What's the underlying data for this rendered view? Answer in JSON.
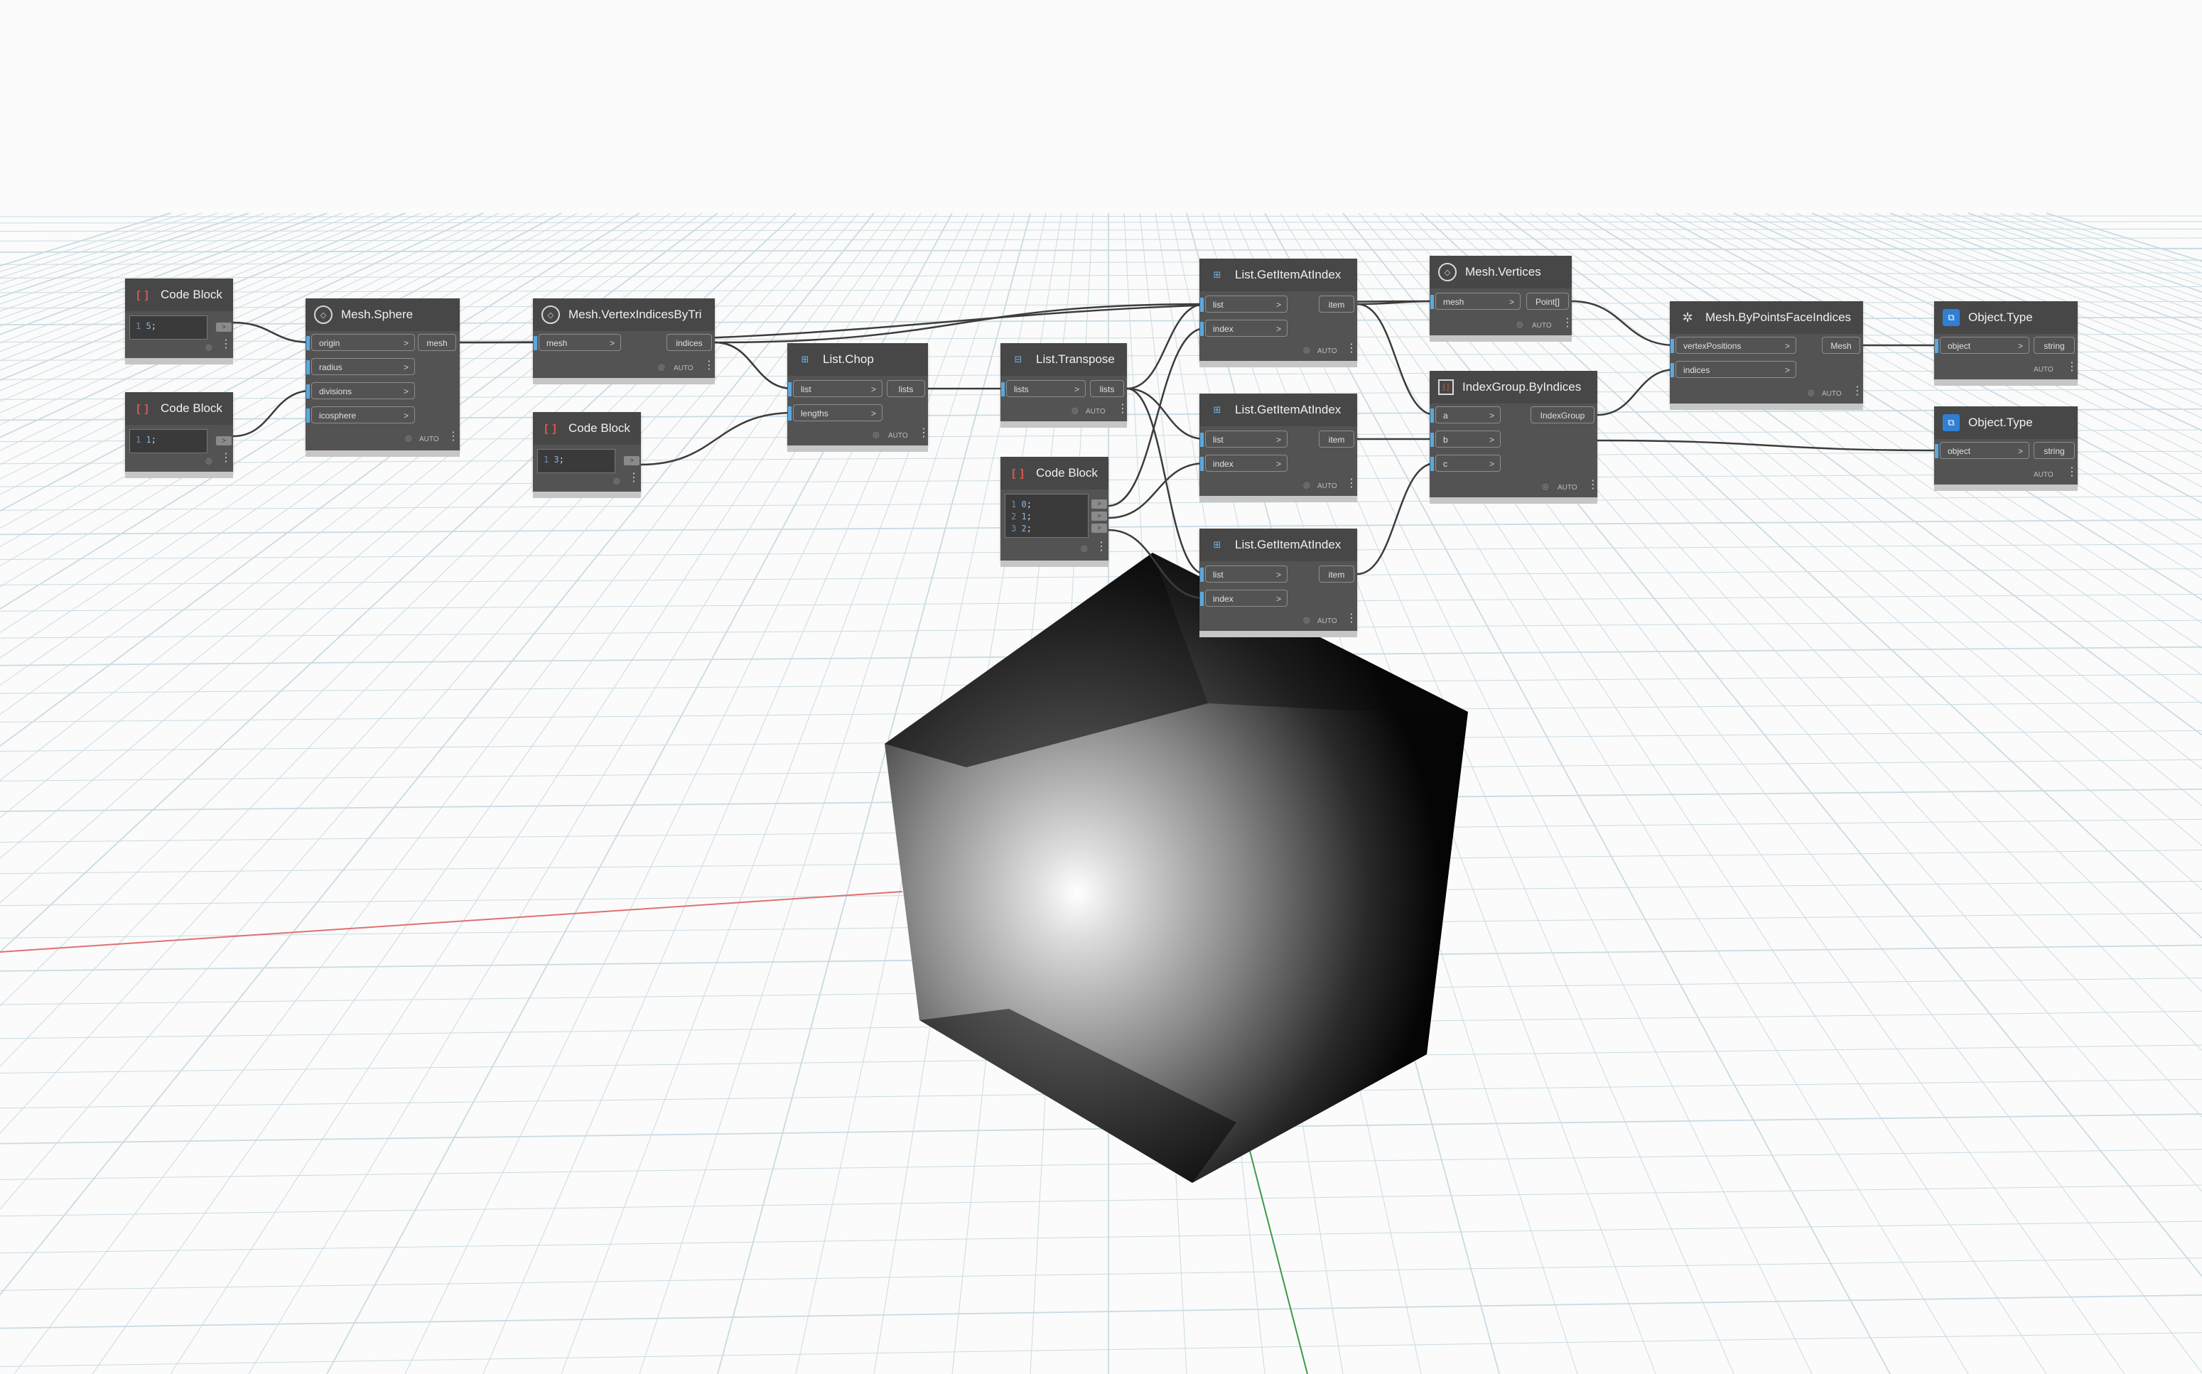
{
  "canvas": {
    "background": "#fbfbfb"
  },
  "nodes": {
    "cb1": {
      "title": "Code Block",
      "line_no": "1",
      "code": "5",
      "terminator": ";"
    },
    "cb2": {
      "title": "Code Block",
      "line_no": "1",
      "code": "1",
      "terminator": ";"
    },
    "cb3": {
      "title": "Code Block",
      "line_no": "1",
      "code": "3",
      "terminator": ";"
    },
    "cb4": {
      "title": "Code Block",
      "lines": [
        {
          "no": "1",
          "code": "0",
          "t": ";"
        },
        {
          "no": "2",
          "code": "1",
          "t": ";"
        },
        {
          "no": "3",
          "code": "2",
          "t": ";"
        }
      ]
    },
    "mesh_sphere": {
      "title": "Mesh.Sphere",
      "inputs": [
        "origin",
        "radius",
        "divisions",
        "icosphere"
      ],
      "output": "mesh",
      "lacing": "AUTO"
    },
    "vertex_indices": {
      "title": "Mesh.VertexIndicesByTri",
      "inputs": [
        "mesh"
      ],
      "output": "indices",
      "lacing": "AUTO"
    },
    "list_chop": {
      "title": "List.Chop",
      "inputs": [
        "list",
        "lengths"
      ],
      "output": "lists",
      "lacing": "AUTO"
    },
    "list_transpose": {
      "title": "List.Transpose",
      "inputs": [
        "lists"
      ],
      "output": "lists",
      "lacing": "AUTO"
    },
    "get_item_1": {
      "title": "List.GetItemAtIndex",
      "inputs": [
        "list",
        "index"
      ],
      "output": "item",
      "lacing": "AUTO"
    },
    "get_item_2": {
      "title": "List.GetItemAtIndex",
      "inputs": [
        "list",
        "index"
      ],
      "output": "item",
      "lacing": "AUTO"
    },
    "get_item_3": {
      "title": "List.GetItemAtIndex",
      "inputs": [
        "list",
        "index"
      ],
      "output": "item",
      "lacing": "AUTO"
    },
    "mesh_vertices": {
      "title": "Mesh.Vertices",
      "inputs": [
        "mesh"
      ],
      "output": "Point[]",
      "lacing": "AUTO"
    },
    "index_group": {
      "title": "IndexGroup.ByIndices",
      "inputs": [
        "a",
        "b",
        "c"
      ],
      "output": "IndexGroup",
      "lacing": "AUTO"
    },
    "mesh_by_points": {
      "title": "Mesh.ByPointsFaceIndices",
      "inputs": [
        "vertexPositions",
        "indices"
      ],
      "output": "Mesh",
      "lacing": "AUTO"
    },
    "object_type_1": {
      "title": "Object.Type",
      "inputs": [
        "object"
      ],
      "output": "string",
      "lacing": "AUTO"
    },
    "object_type_2": {
      "title": "Object.Type",
      "inputs": [
        "object"
      ],
      "output": "string",
      "lacing": "AUTO"
    }
  },
  "icons": {
    "code_block": "code-block-icon",
    "mesh": "mesh-node-icon",
    "list": "list-node-icon",
    "index_group": "index-group-icon",
    "object": "object-node-icon",
    "preview": "eye-icon",
    "menu": "vertical-dots-icon"
  },
  "colors": {
    "node_body": "#535353",
    "node_header": "#474747",
    "port_marker": "#5aa9dd",
    "wire": "#3a3a3a",
    "axis_x": "#e07070",
    "axis_y": "#3c9a4a",
    "grid": "#c9dbe3"
  }
}
